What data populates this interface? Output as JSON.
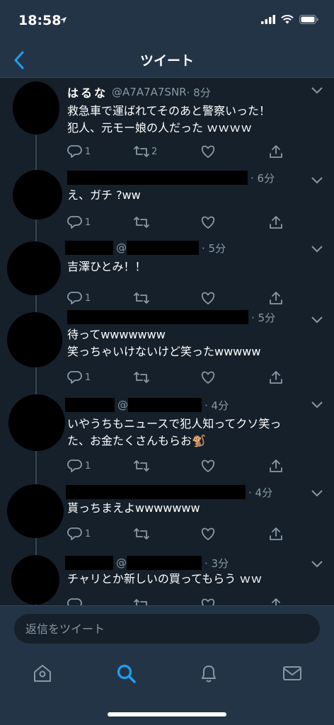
{
  "status_bar": {
    "time": "18:58"
  },
  "nav": {
    "title": "ツイート"
  },
  "tweets": [
    {
      "name": "はるな",
      "handle": "@A7A7A7SNR",
      "time": "· 8分",
      "body": "救急車で運ばれてそのあと警察いった！\n犯人、元モー娘の人だった ｗｗｗｗ",
      "replies": "1",
      "retweets": "2"
    },
    {
      "time": "· 6分",
      "body": "え、ガチ ?ww",
      "replies": "1",
      "retweets": ""
    },
    {
      "handle": "@",
      "time": "· 5分",
      "body": "吉澤ひとみ！！",
      "replies": "1",
      "retweets": ""
    },
    {
      "time": "· 5分",
      "body": "待ってwwwwwww\n笑っちゃいけないけど笑ったwwwww",
      "replies": "1",
      "retweets": ""
    },
    {
      "handle": "@",
      "time": "· 4分",
      "body": "いやうちもニュースで犯人知ってクソ笑っ\nた、お金たくさんもらお🐒",
      "replies": "1",
      "retweets": ""
    },
    {
      "time": "· 4分",
      "body": "貰っちまえよwwwwwww",
      "replies": "1",
      "retweets": ""
    },
    {
      "handle": "@",
      "time": "· 3分",
      "body": "チャリとか新しいの買ってもらう ｗｗ",
      "replies": "",
      "retweets": ""
    }
  ],
  "compose": {
    "placeholder": "返信をツイート"
  },
  "icons": {
    "back": "chevron-left-icon",
    "more": "chevron-down-icon",
    "reply": "reply-icon",
    "retweet": "retweet-icon",
    "like": "heart-icon",
    "share": "share-icon",
    "home": "home-icon",
    "search": "search-icon",
    "notifications": "bell-icon",
    "messages": "mail-icon"
  },
  "colors": {
    "background": "#15202b",
    "bar": "#243447",
    "accent": "#1da1f2",
    "muted": "#8899a6"
  }
}
